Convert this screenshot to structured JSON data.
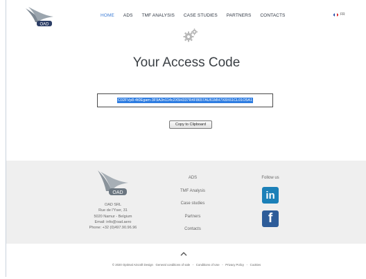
{
  "header": {
    "logo_text": "OAD",
    "nav": [
      {
        "label": "HOME",
        "active": true
      },
      {
        "label": "ADS",
        "active": false
      },
      {
        "label": "TMF ANALYSIS",
        "active": false
      },
      {
        "label": "CASE STUDIES",
        "active": false
      },
      {
        "label": "PARTNERS",
        "active": false
      },
      {
        "label": "CONTACTS",
        "active": false
      }
    ],
    "language": "FR"
  },
  "main": {
    "title": "Your Access Code",
    "access_code": "C02FVp8-4t0Egam-3F9A3n114c2X5H337R4F8657AU61MH7X8X61CL01O5A1",
    "copy_button": "Copy to Clipboard"
  },
  "footer": {
    "logo_text": "OAD",
    "company_lines": [
      "OAD SRL",
      "Rue de l'Yser, 31",
      "5020 Namur - Belgium",
      "Email: info@oad.aero",
      "Phone: +32 (0)497.90.96.96"
    ],
    "links": [
      "ADS",
      "TMF Analysis",
      "Case studies",
      "Partners",
      "Contacts"
    ],
    "follow_label": "Follow us",
    "social": {
      "linkedin": "in",
      "facebook": "f"
    },
    "legal": {
      "copyright": "© 2020 Optimal Aircraft Design",
      "terms": "General conditions of sale",
      "conditions": "Conditions of Use",
      "privacy": "Privacy Policy",
      "cookies": "Cookies",
      "separator": "-"
    }
  },
  "colors": {
    "nav_active": "#3a7bd5",
    "code_highlight": "#2f7de1",
    "footer_bg": "#efefef",
    "linkedin": "#1b80b8",
    "facebook": "#2d5c99"
  },
  "icons": {
    "header_gear": "gears-icon",
    "scroll_top": "chevron-up-icon",
    "lang_flag": "french-flag-icon"
  }
}
